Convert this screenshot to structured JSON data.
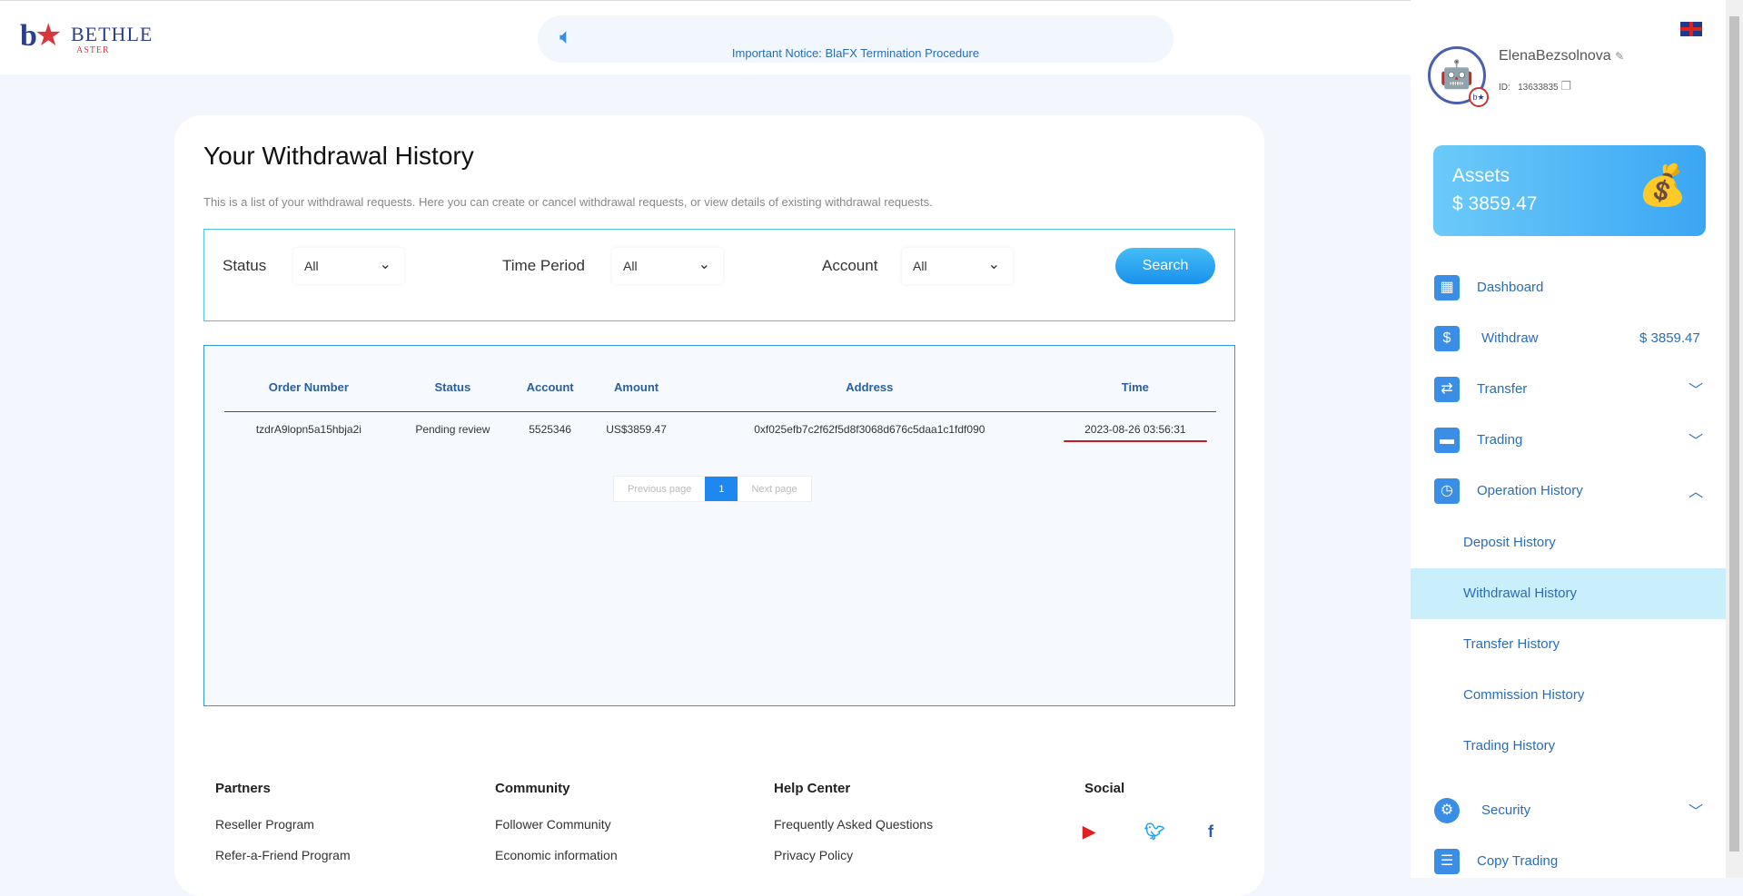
{
  "header": {
    "logo_main": "BETHLE",
    "logo_sub": "ASTER",
    "notice": "Important Notice: BlaFX Termination Procedure"
  },
  "page": {
    "title": "Your Withdrawal History",
    "subtitle": "This is a list of your withdrawal requests. Here you can create or cancel withdrawal requests, or view details of existing withdrawal requests."
  },
  "filters": {
    "status_label": "Status",
    "status_value": "All",
    "period_label": "Time Period",
    "period_value": "All",
    "account_label": "Account",
    "account_value": "All",
    "search_label": "Search"
  },
  "table": {
    "headers": [
      "Order Number",
      "Status",
      "Account",
      "Amount",
      "Address",
      "Time"
    ],
    "rows": [
      [
        "tzdrA9lopn5a15hbja2i",
        "Pending review",
        "5525346",
        "US$3859.47",
        "0xf025efb7c2f62f5d8f3068d676c5daa1c1fdf090",
        "2023-08-26 03:56:31"
      ]
    ]
  },
  "pagination": {
    "prev": "Previous page",
    "current": "1",
    "next": "Next page"
  },
  "footer": {
    "cols": [
      {
        "title": "Partners",
        "links": [
          "Reseller Program",
          "Refer-a-Friend Program"
        ]
      },
      {
        "title": "Community",
        "links": [
          "Follower Community",
          "Economic information"
        ]
      },
      {
        "title": "Help Center",
        "links": [
          "Frequently Asked Questions",
          "Privacy Policy"
        ]
      },
      {
        "title": "Social"
      }
    ]
  },
  "user": {
    "name": "ElenaBezsolnova",
    "id_label": "ID:",
    "id": "13633835"
  },
  "assets": {
    "label": "Assets",
    "value": "$ 3859.47"
  },
  "nav": {
    "dashboard": "Dashboard",
    "withdraw": "Withdraw",
    "withdraw_amount": "$ 3859.47",
    "transfer": "Transfer",
    "trading": "Trading",
    "operation_history": "Operation History",
    "deposit_history": "Deposit History",
    "withdrawal_history": "Withdrawal History",
    "transfer_history": "Transfer History",
    "commission_history": "Commission History",
    "trading_history": "Trading History",
    "security": "Security",
    "copy_trading": "Copy Trading"
  },
  "colors": {
    "accent": "#1e88f0",
    "nav_text": "#2a6db5",
    "active_bg": "#c9eefc"
  }
}
